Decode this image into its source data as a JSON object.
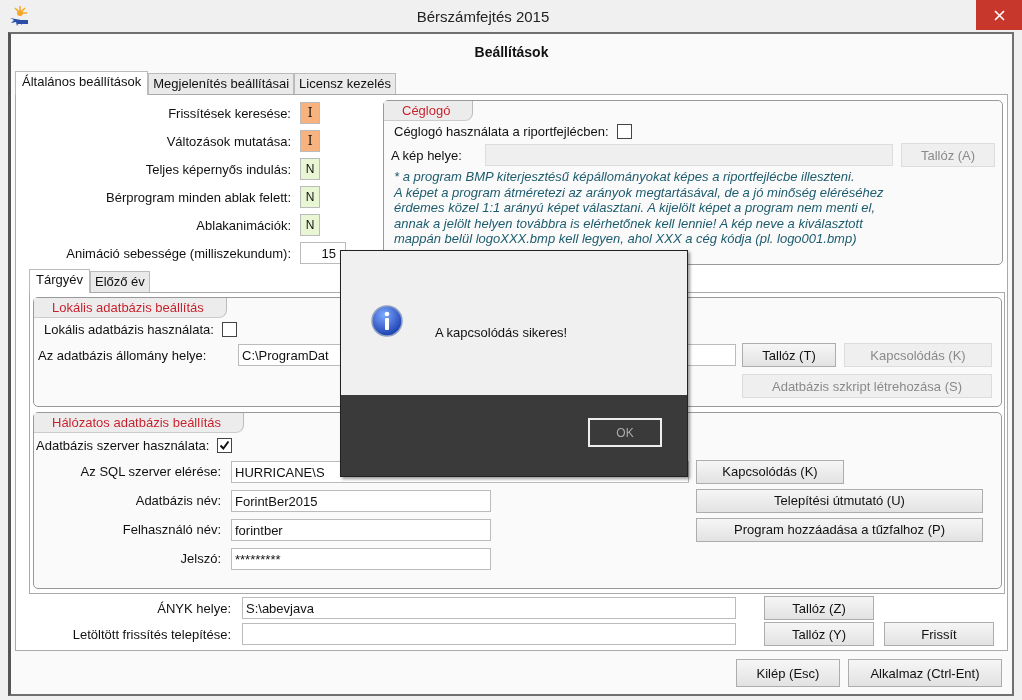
{
  "window": {
    "title": "Bérszámfejtés 2015"
  },
  "heading": "Beállítások",
  "tabs": [
    {
      "label": "Általános beállítások",
      "selected": true
    },
    {
      "label": "Megjelenítés beállításai",
      "selected": false
    },
    {
      "label": "Licensz kezelés",
      "selected": false
    }
  ],
  "toggles": [
    {
      "label": "Frissítések keresése:",
      "value": "I",
      "on": true
    },
    {
      "label": "Változások mutatása:",
      "value": "I",
      "on": true
    },
    {
      "label": "Teljes képernyős indulás:",
      "value": "N",
      "on": false
    },
    {
      "label": "Bérprogram minden ablak felett:",
      "value": "N",
      "on": false
    },
    {
      "label": "Ablakanimációk:",
      "value": "N",
      "on": false
    }
  ],
  "animation_speed": {
    "label": "Animáció sebessége (milliszekundum):",
    "value": "15"
  },
  "logo_group": {
    "title": "Céglogó",
    "use_label": "Céglogó használata a riportfejlécben:",
    "checked": false,
    "path_label": "A kép helye:",
    "path_disabled": true,
    "button": {
      "label": "Tallóz (A)",
      "disabled": true
    },
    "note": [
      "* a program BMP kiterjesztésű képállományokat képes a riportfejlécbe illeszteni.",
      "A képet a program átméretezi az arányok megtartásával, de a jó minőség eléréséhez",
      "érdemes közel 1:1 arányú képet választani. A kijelölt képet a program nem menti el,",
      "annak a jelölt helyen továbbra is elérhetőnek kell lennie! A kép neve a kiválasztott",
      "mappán belül logoXXX.bmp kell legyen, ahol XXX a cég kódja (pl. logo001.bmp)"
    ]
  },
  "year_tabs": [
    {
      "label": "Tárgyév",
      "selected": true
    },
    {
      "label": "Előző év",
      "selected": false
    }
  ],
  "local_group": {
    "title": "Lokális adatbázis beállítás",
    "use_label": "Lokális adatbázis használata:",
    "checked": false,
    "path_label": "Az adatbázis állomány helye:",
    "path_value": "C:\\ProgramDat",
    "buttons": [
      {
        "label": "Tallóz (T)",
        "disabled": false
      },
      {
        "label": "Kapcsolódás (K)",
        "disabled": true
      },
      {
        "label": "Adatbázis szkript létrehozása (S)",
        "disabled": true
      }
    ]
  },
  "network_group": {
    "title": "Hálózatos adatbázis beállítás",
    "use_label": "Adatbázis szerver használata:",
    "checked": true,
    "fields": [
      {
        "label": "Az SQL szerver elérése:",
        "value": "HURRICANE\\S"
      },
      {
        "label": "Adatbázis név:",
        "value": "ForintBer2015"
      },
      {
        "label": "Felhasználó név:",
        "value": "forintber"
      },
      {
        "label": "Jelszó:",
        "value": "*********"
      }
    ],
    "buttons": [
      {
        "label": "Kapcsolódás (K)",
        "disabled": false
      },
      {
        "label": "Telepítési útmutató (U)",
        "disabled": false
      },
      {
        "label": "Program hozzáadása a tűzfalhoz (P)",
        "disabled": false
      }
    ]
  },
  "bottom_fields": [
    {
      "label": "ÁNYK helye:",
      "value": "S:\\abevjava",
      "buttons": [
        {
          "label": "Tallóz (Z)",
          "disabled": false
        }
      ]
    },
    {
      "label": "Letöltött frissítés telepítése:",
      "buttons": [
        {
          "label": "Tallóz (Y)",
          "disabled": false
        },
        {
          "label": "Frissít",
          "disabled": false
        }
      ]
    }
  ],
  "footer_buttons": [
    {
      "label": "Kilép (Esc)",
      "disabled": false
    },
    {
      "label": "Alkalmaz (Ctrl-Ent)",
      "disabled": false
    }
  ],
  "dialog": {
    "message": "A kapcsolódás sikeres!",
    "button": "OK"
  }
}
